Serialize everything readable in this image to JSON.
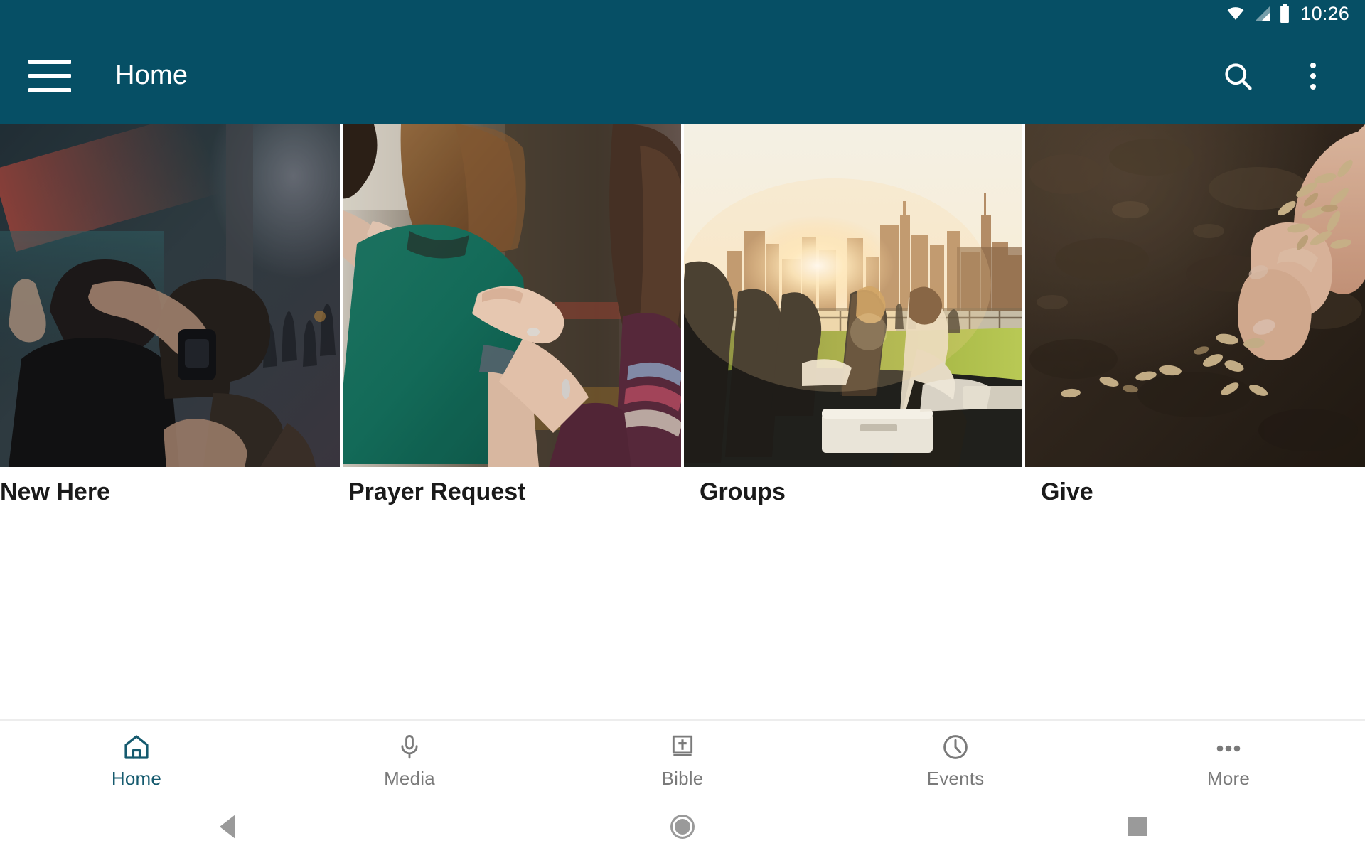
{
  "status_bar": {
    "time": "10:26",
    "icons": [
      "wifi-icon",
      "cellular-signal-icon",
      "battery-icon"
    ]
  },
  "app_bar": {
    "title": "Home",
    "menu_icon": "hamburger-menu-icon",
    "search_icon": "search-icon",
    "overflow_icon": "overflow-menu-icon",
    "background_color": "#064F65"
  },
  "cards": [
    {
      "label": "New Here",
      "image_alt": "two men embracing at a worship service"
    },
    {
      "label": "Prayer Request",
      "image_alt": "hands placed on a woman's shoulders in prayer"
    },
    {
      "label": "Groups",
      "image_alt": "friends picnicking on grass at sunset with city skyline"
    },
    {
      "label": "Give",
      "image_alt": "hand sowing wheat seeds into dark soil"
    }
  ],
  "bottom_nav": {
    "active_color": "#155A6E",
    "inactive_color": "#7a7a7a",
    "items": [
      {
        "label": "Home",
        "icon": "home-icon",
        "active": true
      },
      {
        "label": "Media",
        "icon": "microphone-icon",
        "active": false
      },
      {
        "label": "Bible",
        "icon": "bible-book-icon",
        "active": false
      },
      {
        "label": "Events",
        "icon": "clock-icon",
        "active": false
      },
      {
        "label": "More",
        "icon": "ellipsis-icon",
        "active": false
      }
    ]
  },
  "system_nav": {
    "back": "back-triangle-icon",
    "home": "home-circle-icon",
    "recents": "recents-square-icon"
  }
}
